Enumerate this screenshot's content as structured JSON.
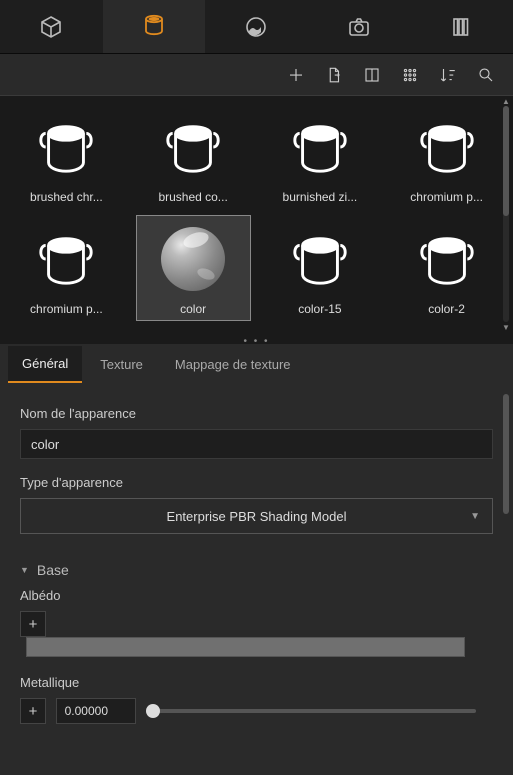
{
  "topTabs": [
    "model",
    "material",
    "image",
    "camera",
    "library"
  ],
  "activeTopTab": 1,
  "toolbar": [
    "add",
    "export",
    "split-view",
    "grid-view",
    "sort",
    "search"
  ],
  "materials": [
    {
      "label": "brushed chr...",
      "thumb": "bucket"
    },
    {
      "label": "brushed co...",
      "thumb": "bucket"
    },
    {
      "label": "burnished zi...",
      "thumb": "bucket"
    },
    {
      "label": "chromium p...",
      "thumb": "bucket"
    },
    {
      "label": "chromium p...",
      "thumb": "bucket"
    },
    {
      "label": "color",
      "thumb": "sphere",
      "selected": true
    },
    {
      "label": "color-15",
      "thumb": "bucket"
    },
    {
      "label": "color-2",
      "thumb": "bucket"
    }
  ],
  "lowerTabs": [
    {
      "label": "Général",
      "active": true
    },
    {
      "label": "Texture"
    },
    {
      "label": "Mappage de texture"
    }
  ],
  "general": {
    "nameLabel": "Nom de l'apparence",
    "nameValue": "color",
    "typeLabel": "Type d'apparence",
    "typeValue": "Enterprise PBR Shading Model",
    "baseSection": "Base",
    "albedoLabel": "Albédo",
    "metallicLabel": "Metallique",
    "metallicValue": "0.00000"
  }
}
